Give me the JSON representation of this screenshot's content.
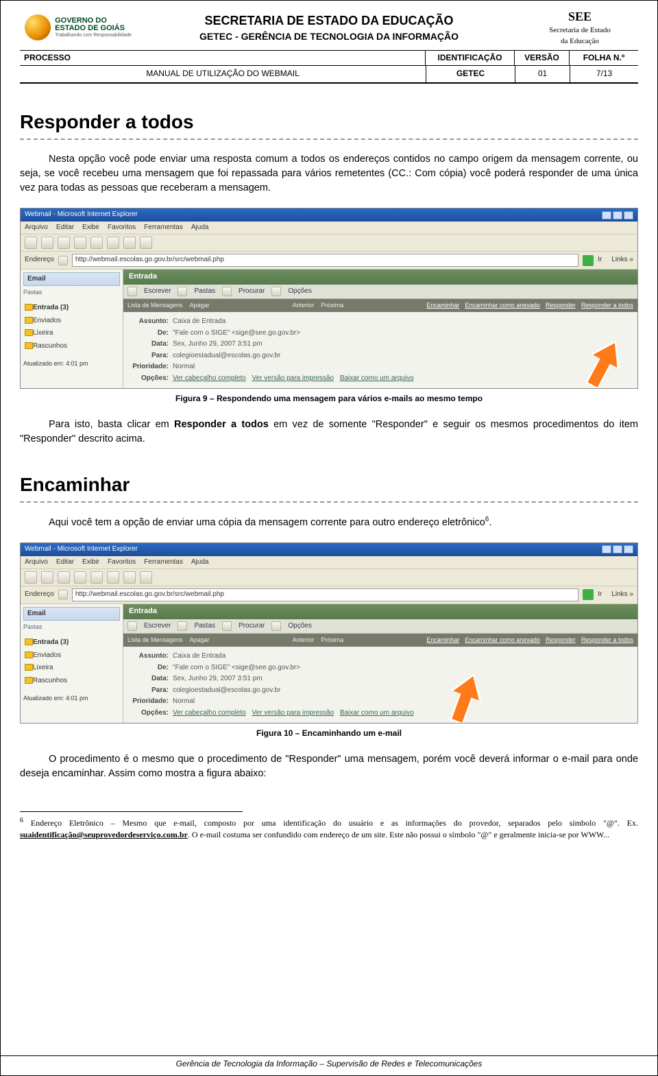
{
  "header": {
    "org_line1": "SECRETARIA DE ESTADO DA EDUCAÇÃO",
    "org_line2_a": "GETEC - ",
    "org_line2_b": "GERÊNCIA DE TECNOLOGIA DA INFORMAÇÃO",
    "left_logo": {
      "l1": "GOVERNO DO",
      "l2": "ESTADO DE GOIÁS",
      "l3": "Trabalhando com Responsabilidade"
    },
    "right_logo": {
      "see": "SEE",
      "sub1": "Secretaria de Estado",
      "sub2": "da Educação"
    }
  },
  "proc": {
    "labels": {
      "processo": "PROCESSO",
      "ident": "IDENTIFICAÇÃO",
      "versao": "VERSÃO",
      "folha": "FOLHA N.º"
    },
    "values": {
      "manual": "MANUAL DE UTILIZAÇÃO DO WEBMAIL",
      "ident": "GETEC",
      "versao": "01",
      "folha": "7/13"
    }
  },
  "sections": {
    "responder": {
      "title": "Responder a todos",
      "p1": "Nesta opção você pode enviar uma resposta comum a todos os endereços contidos no campo origem da mensagem corrente, ou seja, se você recebeu uma mensagem que foi repassada para vários remetentes (CC.: Com cópia) você poderá responder de uma única vez para todas as pessoas que receberam a mensagem.",
      "cap": "Figura 9 – Respondendo uma mensagem para vários e-mails ao mesmo tempo",
      "p2_a": "Para isto, basta clicar em ",
      "p2_b": "Responder a todos",
      "p2_c": " em vez de somente \"Responder\" e seguir os mesmos procedimentos do item \"Responder\" descrito acima."
    },
    "encaminhar": {
      "title": "Encaminhar",
      "p1_a": "Aqui você tem a opção de enviar uma cópia da mensagem corrente para outro endereço eletrônico",
      "p1_sup": "6",
      "p1_b": ".",
      "cap": "Figura 10 – Encaminhando um e-mail",
      "p2": "O procedimento é o mesmo que o procedimento de \"Responder\" uma mensagem, porém você deverá informar o e-mail para onde deseja encaminhar. Assim como mostra a figura abaixo:"
    }
  },
  "screenshot": {
    "title": "Webmail - Microsoft Internet Explorer",
    "menu": [
      "Arquivo",
      "Editar",
      "Exibir",
      "Favoritos",
      "Ferramentas",
      "Ajuda"
    ],
    "addr_label": "Endereço",
    "url": "http://webmail.escolas.go.gov.br/src/webmail.php",
    "go": "Ir",
    "links": "Links »",
    "side": {
      "email": "Email",
      "pastas_label": "Pastas",
      "items": [
        "Entrada (3)",
        "Enviados",
        "Lixeira",
        "Rascunhos"
      ],
      "updated": "Atualizado em: 4:01 pm"
    },
    "content": {
      "entrada": "Entrada",
      "actions": [
        "Escrever",
        "Pastas",
        "Procurar",
        "Opções"
      ],
      "darkbar_left": [
        "Lista de Mensagens",
        "Apagar"
      ],
      "darkbar_mid": [
        "Anterior",
        "Próxima"
      ],
      "darkbar_right": [
        "Encaminhar",
        "Encaminhar como anexado",
        "Responder",
        "Responder a todos"
      ],
      "meta": {
        "assunto_l": "Assunto:",
        "assunto_v": "Caixa de Entrada",
        "de_l": "De:",
        "de_v": "\"Fale com o SIGE\" <sige@see.go.gov.br>",
        "data_l": "Data:",
        "data_v": "Sex, Junho 29, 2007 3:51 pm",
        "para_l": "Para:",
        "para_v": "colegioestadual@escolas.go.gov.br",
        "prio_l": "Prioridade:",
        "prio_v": "Normal",
        "opc_l": "Opções:",
        "opc_links": [
          "Ver cabeçalho completo",
          "Ver versão para impressão",
          "Baixar como um arquivo"
        ]
      }
    }
  },
  "footnote": {
    "num": "6",
    "text_a": " Endereço Eletrônico – Mesmo que e-mail, composto por uma identificação do usuário e as informações do provedor, separados pelo símbolo \"@\". Ex. ",
    "link": "suaidentificação@seuprovedordeserviço.com.br",
    "text_b": ". O e-mail costuma ser confundido com endereço de um site. Este não possui o símbolo \"@\" e geralmente inicia-se por WWW..."
  },
  "footer": "Gerência de Tecnologia da Informação – Supervisão de Redes e Telecomunicações"
}
